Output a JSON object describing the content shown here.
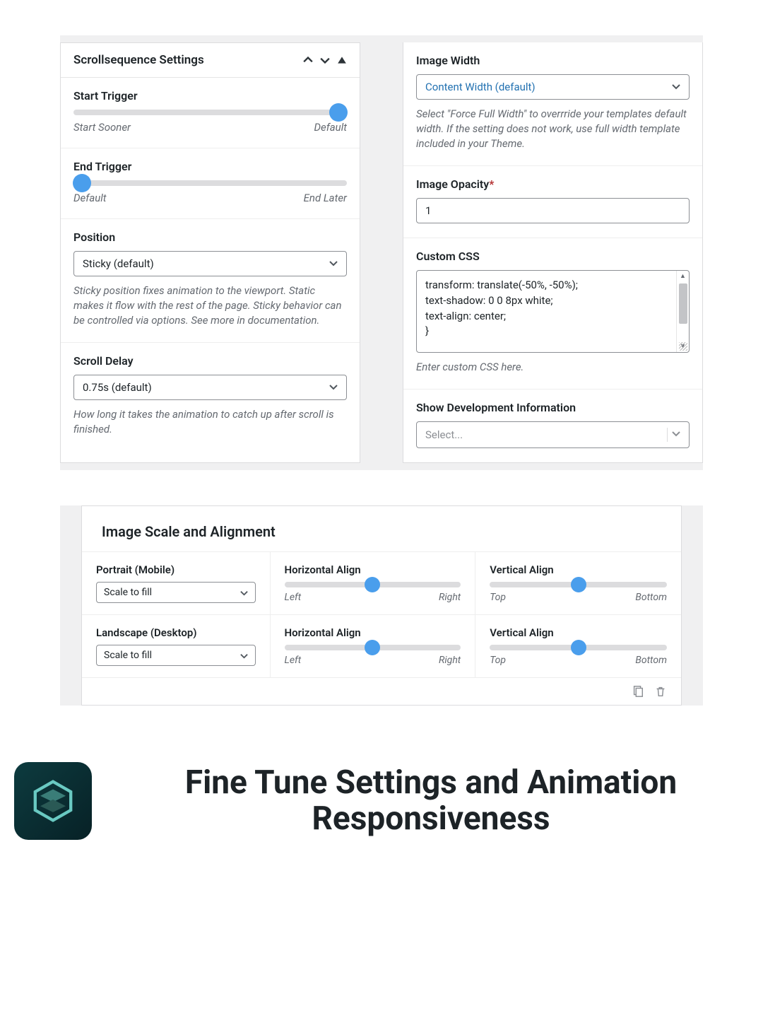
{
  "left": {
    "title": "Scrollsequence Settings",
    "start": {
      "label": "Start Trigger",
      "left": "Start Sooner",
      "right": "Default"
    },
    "end": {
      "label": "End Trigger",
      "left": "Default",
      "right": "End Later"
    },
    "position": {
      "label": "Position",
      "value": "Sticky (default)",
      "help": "Sticky position fixes animation to the viewport. Static makes it flow with the rest of the page. Sticky behavior can be controlled via options. See more in documentation."
    },
    "delay": {
      "label": "Scroll Delay",
      "value": "0.75s (default)",
      "help": "How long it takes the animation to catch up after scroll is finished."
    }
  },
  "right": {
    "imgwidth": {
      "label": "Image Width",
      "value": "Content Width (default)",
      "help": "Select \"Force Full Width\" to overrride your templates default width. If the setting does not work, use full width template included in your Theme."
    },
    "opacity": {
      "label": "Image Opacity",
      "value": "1"
    },
    "css": {
      "label": "Custom CSS",
      "value": "transform: translate(-50%, -50%);\ntext-shadow: 0 0 8px white;\ntext-align: center;\n}",
      "help": "Enter custom CSS here."
    },
    "dev": {
      "label": "Show Development Information",
      "placeholder": "Select..."
    }
  },
  "scale": {
    "title": "Image Scale and Alignment",
    "rows": [
      {
        "mode": "Portrait (Mobile)",
        "select": "Scale to fill",
        "hlabel": "Horizontal Align",
        "hleft": "Left",
        "hright": "Right",
        "vlabel": "Vertical Align",
        "vleft": "Top",
        "vright": "Bottom"
      },
      {
        "mode": "Landscape (Desktop)",
        "select": "Scale to fill",
        "hlabel": "Horizontal Align",
        "hleft": "Left",
        "hright": "Right",
        "vlabel": "Vertical Align",
        "vleft": "Top",
        "vright": "Bottom"
      }
    ]
  },
  "footer_title": "Fine Tune Settings and Animation Responsiveness"
}
